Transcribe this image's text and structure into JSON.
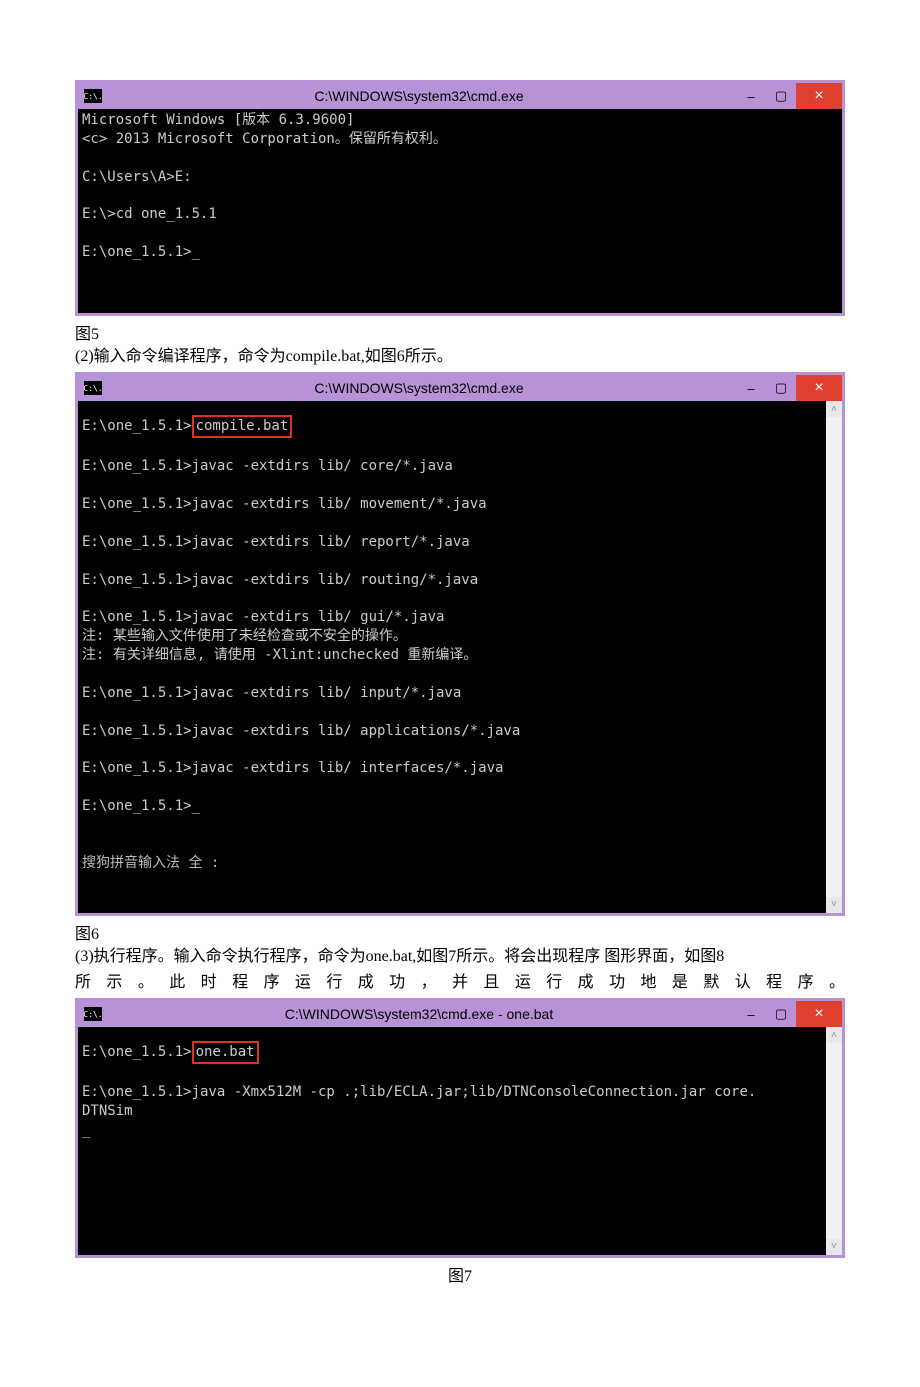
{
  "figures": {
    "fig5": {
      "title": "C:\\WINDOWS\\system32\\cmd.exe",
      "icon": "C:\\.",
      "content": "Microsoft Windows [版本 6.3.9600]\n<c> 2013 Microsoft Corporation。保留所有权利。\n\nC:\\Users\\A>E:\n\nE:\\>cd one_1.5.1\n\nE:\\one_1.5.1>_\n\n\n",
      "caption": "图5"
    },
    "fig6": {
      "intro": "(2)输入命令编译程序，命令为compile.bat,如图6所示。",
      "title": "C:\\WINDOWS\\system32\\cmd.exe",
      "icon": "C:\\.",
      "prompt_prefix": "E:\\one_1.5.1>",
      "highlighted_cmd": "compile.bat",
      "content_after": "\n\nE:\\one_1.5.1>javac -extdirs lib/ core/*.java\n\nE:\\one_1.5.1>javac -extdirs lib/ movement/*.java\n\nE:\\one_1.5.1>javac -extdirs lib/ report/*.java\n\nE:\\one_1.5.1>javac -extdirs lib/ routing/*.java\n\nE:\\one_1.5.1>javac -extdirs lib/ gui/*.java\n注: 某些输入文件使用了未经检查或不安全的操作。\n注: 有关详细信息, 请使用 -Xlint:unchecked 重新编译。\n\nE:\\one_1.5.1>javac -extdirs lib/ input/*.java\n\nE:\\one_1.5.1>javac -extdirs lib/ applications/*.java\n\nE:\\one_1.5.1>javac -extdirs lib/ interfaces/*.java\n\nE:\\one_1.5.1>_\n\n",
      "ime_text": "搜狗拼音输入法 全 :",
      "caption": "图6"
    },
    "fig7": {
      "intro_line1": "(3)执行程序。输入命令执行程序，命令为one.bat,如图7所示。将会出现程序 图形界面，如图8",
      "intro_line2": "所示。此时程序运行成功，并且运行成功地是默认程序。",
      "title": "C:\\WINDOWS\\system32\\cmd.exe - one.bat",
      "icon": "C:\\.",
      "prompt_prefix": "E:\\one_1.5.1>",
      "highlighted_cmd": "one.bat",
      "content_after": "\n\nE:\\one_1.5.1>java -Xmx512M -cp .;lib/ECLA.jar;lib/DTNConsoleConnection.jar core.\nDTNSim\n_\n\n\n\n",
      "caption": "图7"
    }
  },
  "window_controls": {
    "minimize": "–",
    "maximize": "▢",
    "close": "×"
  },
  "scroll": {
    "up": "˄",
    "down": "˅"
  }
}
